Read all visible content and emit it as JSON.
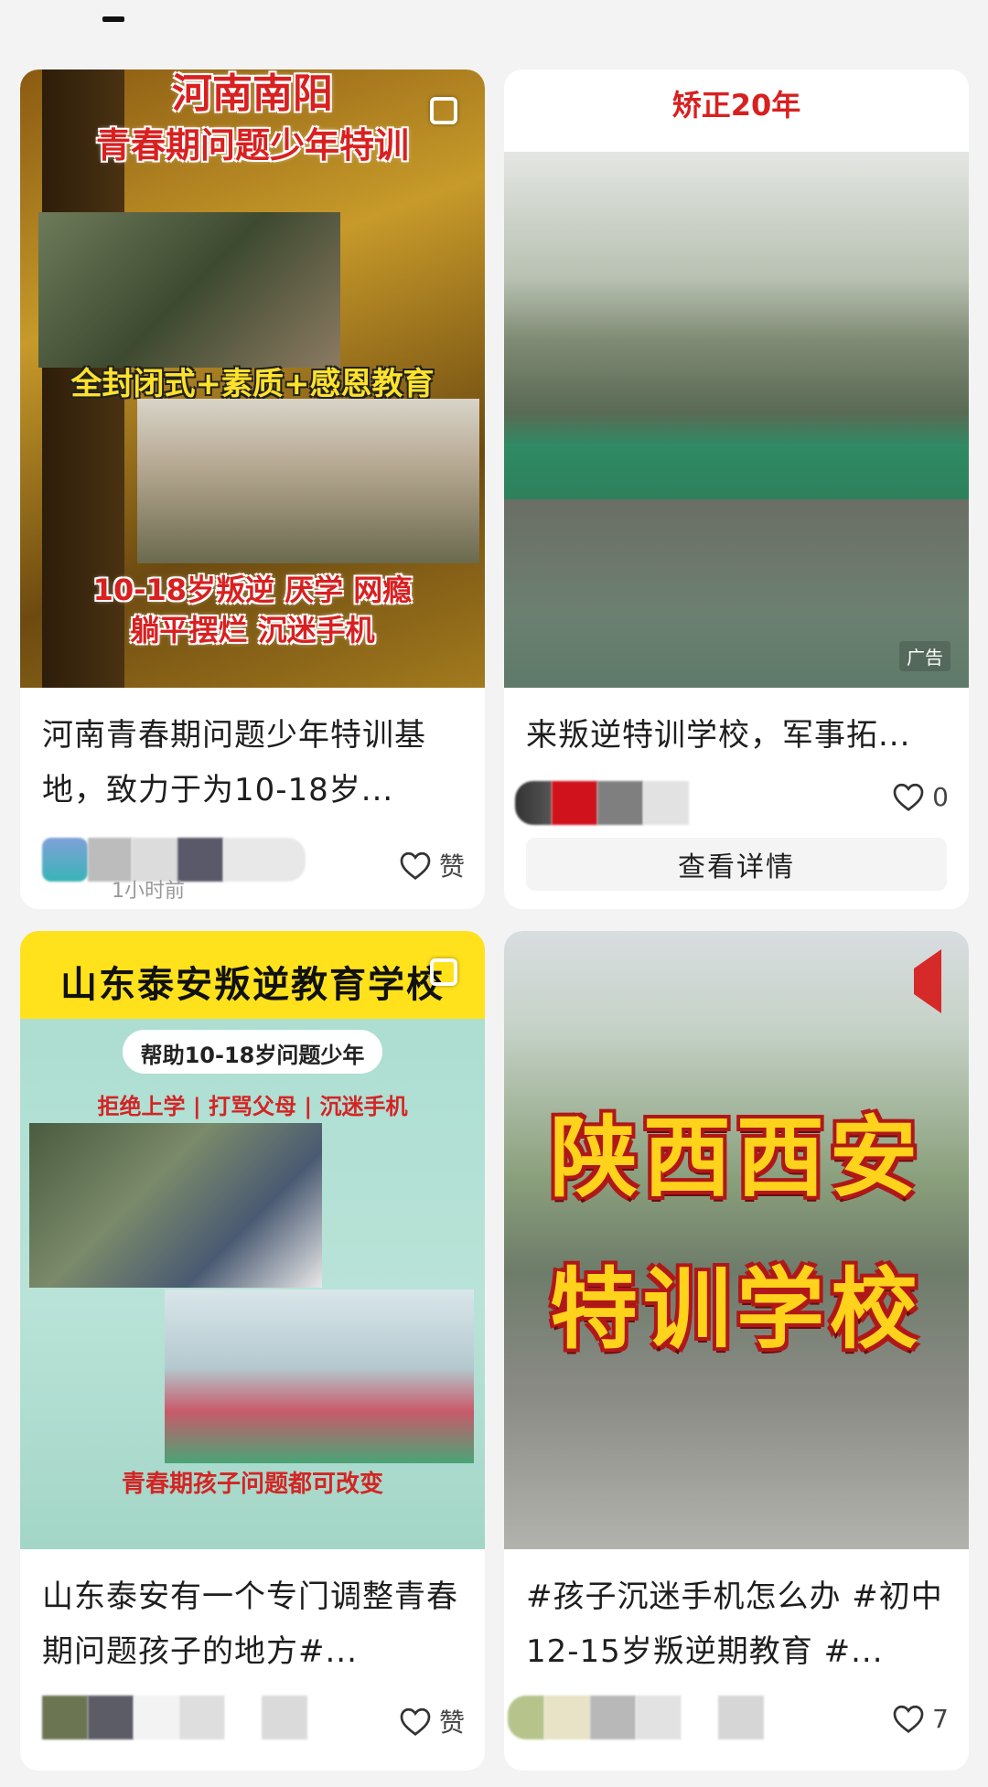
{
  "cards": [
    {
      "poster": {
        "top_title": "河南南阳",
        "subtitle": "青春期问题少年特训",
        "middle_banner": "全封闭式+素质+感恩教育",
        "bottom_line1": "10-18岁叛逆 厌学 网瘾",
        "bottom_line2": "躺平摆烂 沉迷手机"
      },
      "title": "河南青春期问题少年特训基地，致力于为10-18岁...",
      "time": "1小时前",
      "like_label": "赞"
    },
    {
      "poster": {
        "top_title": "矫正20年"
      },
      "ad_badge": "广告",
      "title": "来叛逆特训学校，军事拓...",
      "like_label": "0",
      "detail_button": "查看详情"
    },
    {
      "poster": {
        "top_title": "山东泰安叛逆教育学校",
        "pill": "帮助10-18岁问题少年",
        "tags": "拒绝上学 | 打骂父母 | 沉迷手机",
        "bottom": "青春期孩子问题都可改变"
      },
      "title": "山东泰安有一个专门调整青春期问题孩子的地方#...",
      "like_label": "赞"
    },
    {
      "poster": {
        "line1": "陕西西安",
        "line2": "特训学校"
      },
      "title": "#孩子沉迷手机怎么办 #初中12-15岁叛逆期教育 #...",
      "like_label": "7"
    }
  ],
  "colors": {
    "background": "#f3f3f3",
    "card": "#ffffff",
    "poster_red": "#d92020",
    "poster_yellow": "#ffe22a"
  },
  "icons": [
    "heart-outline-icon",
    "copy-icon"
  ]
}
